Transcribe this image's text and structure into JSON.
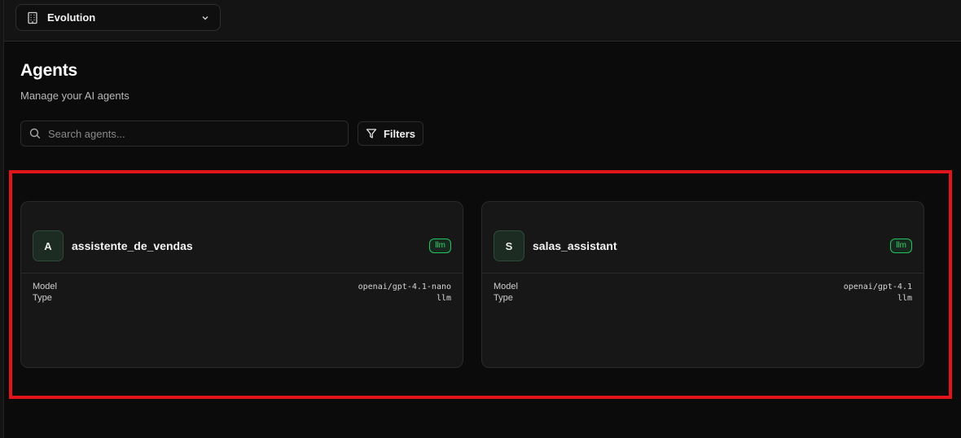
{
  "topbar": {
    "org_selector": {
      "label": "Evolution",
      "icon": "building-icon",
      "chevron_icon": "chevron-down-icon"
    }
  },
  "page": {
    "title": "Agents",
    "subtitle": "Manage your AI agents"
  },
  "search": {
    "placeholder": "Search agents...",
    "value": "",
    "icon": "search-icon"
  },
  "filters": {
    "label": "Filters",
    "icon": "filter-icon"
  },
  "colors": {
    "background": "#0b0b0b",
    "card": "#171717",
    "accent_green": "#22c55e",
    "highlight_red": "#e0141b"
  },
  "agents": [
    {
      "initial": "A",
      "name": "assistente_de_vendas",
      "badge": "llm",
      "model_label": "Model",
      "model": "openai/gpt-4.1-nano",
      "type_label": "Type",
      "type": "llm"
    },
    {
      "initial": "S",
      "name": "salas_assistant",
      "badge": "llm",
      "model_label": "Model",
      "model": "openai/gpt-4.1",
      "type_label": "Type",
      "type": "llm"
    }
  ]
}
